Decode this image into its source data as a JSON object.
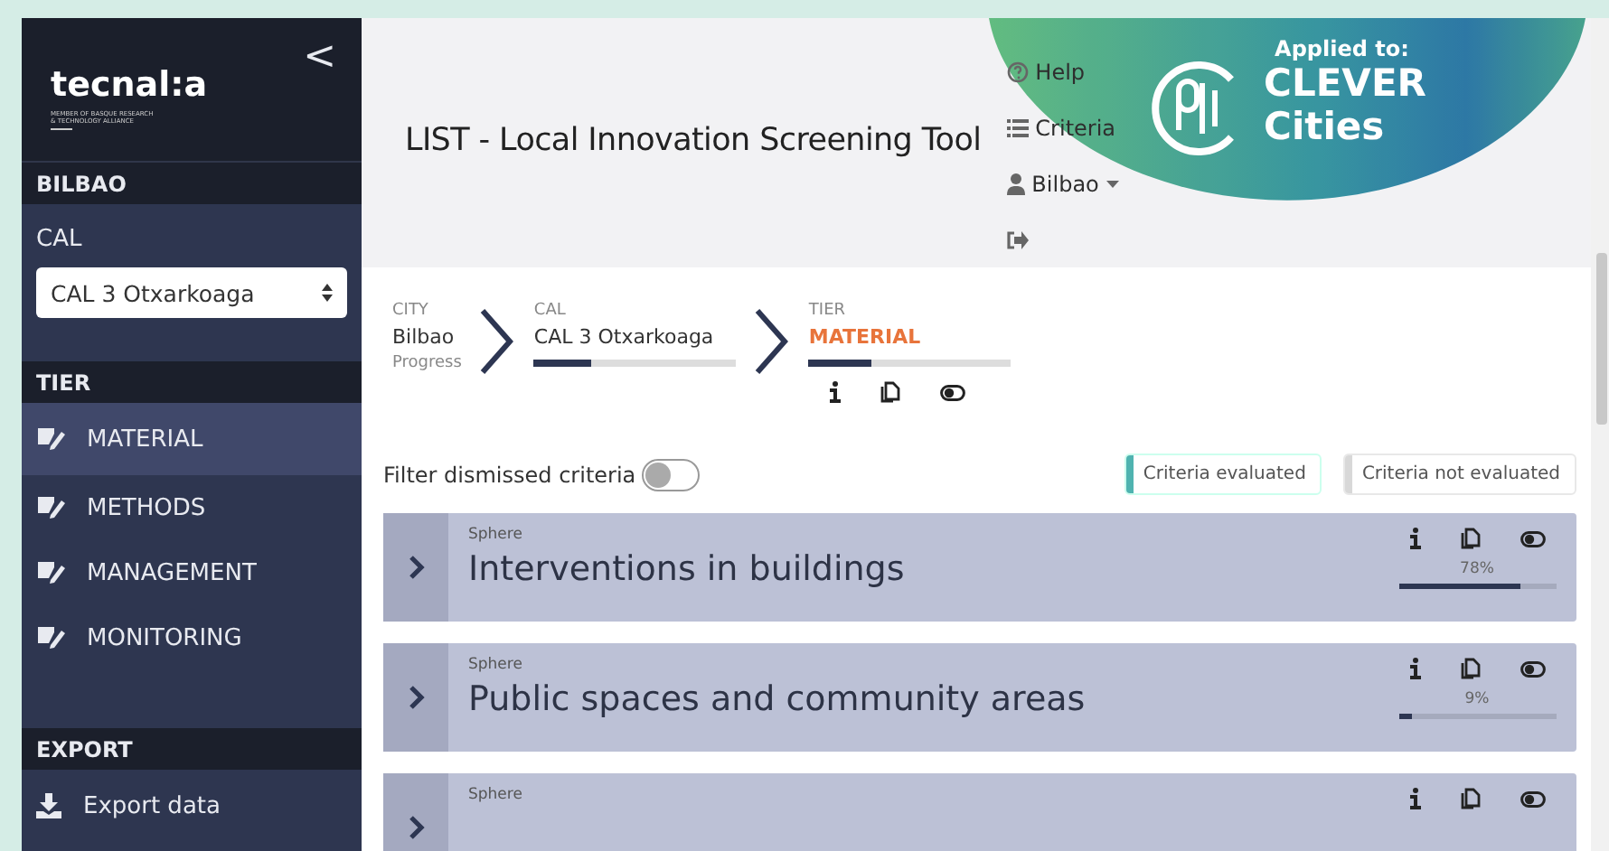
{
  "sidebar": {
    "logo": "tecnal:a",
    "logo_tagline": [
      "MEMBER OF BASQUE RESEARCH",
      "& TECHNOLOGY ALLIANCE"
    ],
    "collapse": "<",
    "city_heading": "BILBAO",
    "cal_label": "CAL",
    "cal_select": "CAL 3 Otxarkoaga",
    "tier_heading": "TIER",
    "tiers": [
      {
        "label": "MATERIAL",
        "selected": true
      },
      {
        "label": "METHODS",
        "selected": false
      },
      {
        "label": "MANAGEMENT",
        "selected": false
      },
      {
        "label": "MONITORING",
        "selected": false
      }
    ],
    "export_heading": "EXPORT",
    "export_item": "Export data"
  },
  "header": {
    "title": "LIST - Local Innovation Screening Tool",
    "nav": [
      {
        "kind": "help",
        "label": "Help"
      },
      {
        "kind": "criteria",
        "label": "Criteria"
      },
      {
        "kind": "user",
        "label": "Bilbao"
      },
      {
        "kind": "logout"
      }
    ],
    "badge": {
      "caption": "Applied to:",
      "line1": "CLEVER",
      "line2": "Cities"
    }
  },
  "breadcrumb": {
    "city": {
      "caption": "CITY",
      "value": "Bilbao",
      "note": "Progress"
    },
    "cal": {
      "caption": "CAL",
      "value": "CAL 3 Otxarkoaga",
      "level": 0.28
    },
    "tier": {
      "caption": "TIER",
      "value": "MATERIAL",
      "level": 0.31
    }
  },
  "filter": {
    "label": "Filter dismissed criteria",
    "on": false
  },
  "legend": [
    {
      "label": "Criteria evaluated",
      "color": "#4fb3b0"
    },
    {
      "label": "Criteria not evaluated",
      "color": "#d8d8d8"
    }
  ],
  "spheres": [
    {
      "caption": "Sphere",
      "title": "Interventions in buildings",
      "percent": "78%",
      "level": 0.78
    },
    {
      "caption": "Sphere",
      "title": "Public spaces and community areas",
      "percent": "9%",
      "level": 0.09
    },
    {
      "caption": "Sphere"
    }
  ]
}
